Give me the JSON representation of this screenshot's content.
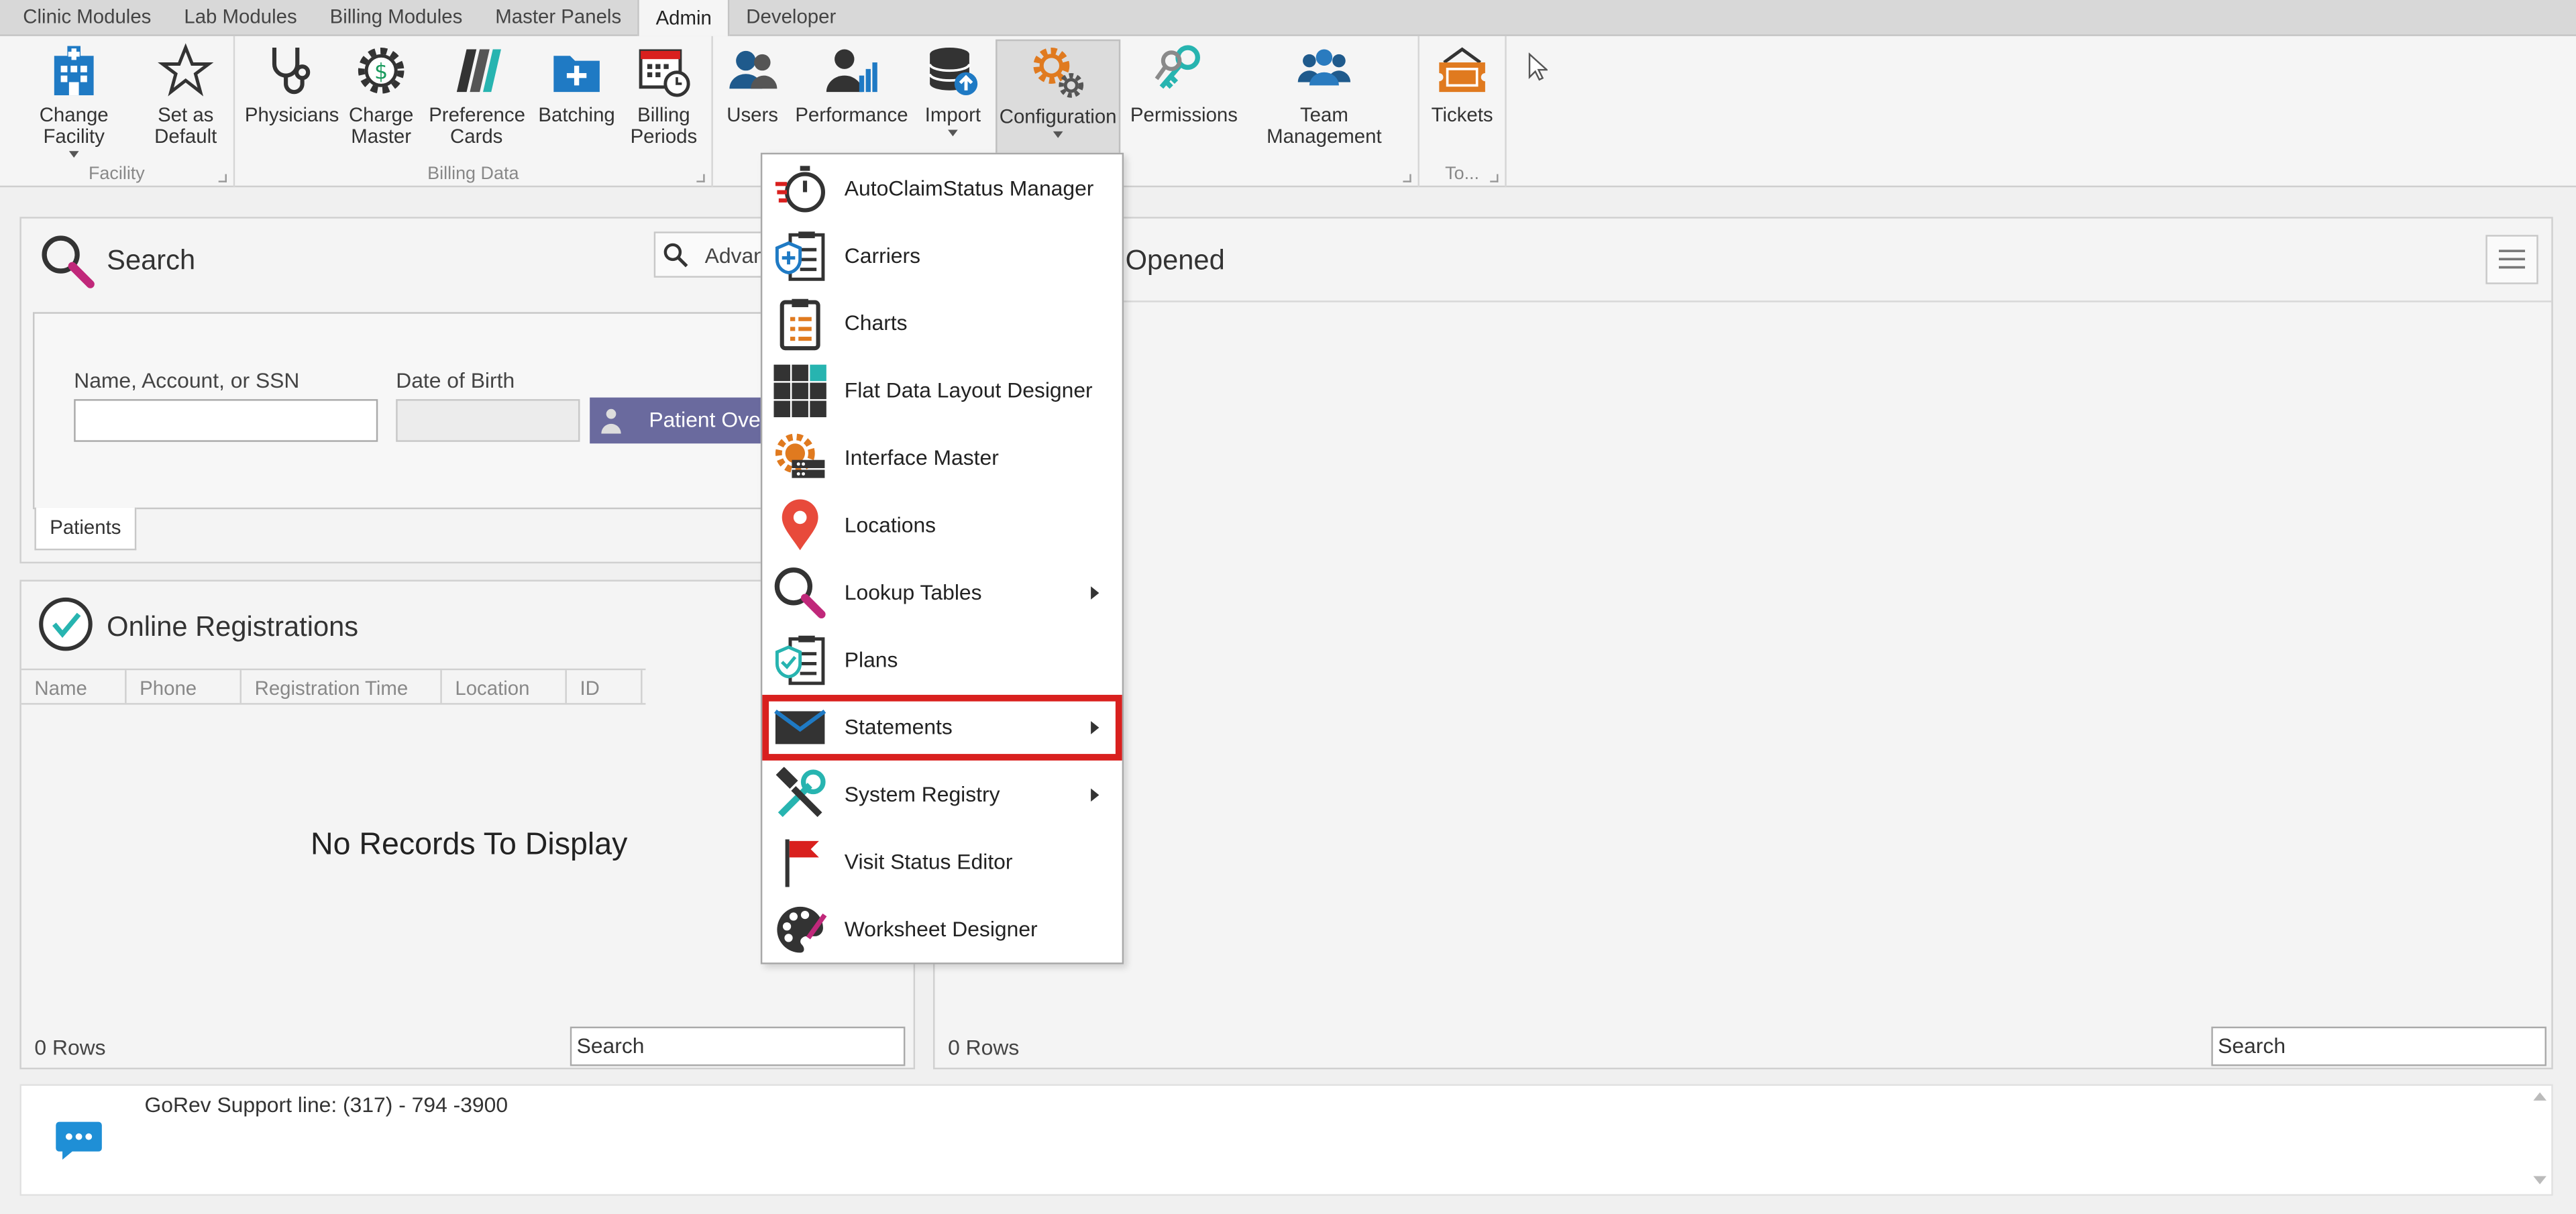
{
  "tabs": [
    "Clinic Modules",
    "Lab Modules",
    "Billing Modules",
    "Master Panels",
    "Admin",
    "Developer"
  ],
  "active_tab": "Admin",
  "ribbon": {
    "facility": {
      "caption": "Facility",
      "change_facility": "Change Facility",
      "set_default": "Set as Default"
    },
    "billing_data": {
      "caption": "Billing Data",
      "physicians": "Physicians",
      "charge_master": "Charge Master",
      "preference_cards": "Preference Cards",
      "batching": "Batching",
      "billing_periods": "Billing Periods"
    },
    "management": {
      "caption_visible": "nt",
      "users": "Users",
      "performance": "Performance",
      "import": "Import",
      "configuration": "Configuration",
      "permissions": "Permissions",
      "team_management": "Team Management"
    },
    "tools": {
      "caption": "To...",
      "tickets": "Tickets"
    }
  },
  "search_panel": {
    "title": "Search",
    "advanced_label": "Advan",
    "name_label": "Name, Account, or SSN",
    "dob_label": "Date of Birth",
    "patient_button": "Patient Ove",
    "patients_tab": "Patients"
  },
  "registrations_panel": {
    "title": "Online Registrations",
    "columns": [
      "Name",
      "Phone",
      "Registration Time",
      "Location",
      "ID"
    ],
    "empty_text": "No Records To Display",
    "rows_count": "0 Rows",
    "search_label": "Search"
  },
  "recent_panel": {
    "title_visible": "Opened",
    "rows_count": "0 Rows",
    "search_label": "Search"
  },
  "configuration_menu": {
    "items": [
      {
        "label": "AutoClaimStatus Manager",
        "icon": "stopwatch-icon",
        "submenu": false
      },
      {
        "label": "Carriers",
        "icon": "shield-clipboard-icon",
        "submenu": false
      },
      {
        "label": "Charts",
        "icon": "chart-document-icon",
        "submenu": false
      },
      {
        "label": "Flat Data Layout Designer",
        "icon": "grid-icon",
        "submenu": false
      },
      {
        "label": "Interface Master",
        "icon": "gear-server-icon",
        "submenu": false
      },
      {
        "label": "Locations",
        "icon": "map-pin-icon",
        "submenu": false
      },
      {
        "label": "Lookup Tables",
        "icon": "magnifier-icon",
        "submenu": true
      },
      {
        "label": "Plans",
        "icon": "shield-check-clipboard-icon",
        "submenu": false
      },
      {
        "label": "Statements",
        "icon": "envelope-icon",
        "submenu": true,
        "highlighted": true
      },
      {
        "label": "System Registry",
        "icon": "tools-icon",
        "submenu": true
      },
      {
        "label": "Visit Status Editor",
        "icon": "flag-icon",
        "submenu": false
      },
      {
        "label": "Worksheet Designer",
        "icon": "palette-icon",
        "submenu": false
      }
    ]
  },
  "footer": {
    "support_text": "GoRev Support line: (317) - 794 -3900"
  },
  "colors": {
    "highlight": "#d9201e",
    "accent_blue": "#1f7ac4",
    "accent_orange": "#e07a1f",
    "purple_button": "#6a6a9e"
  }
}
